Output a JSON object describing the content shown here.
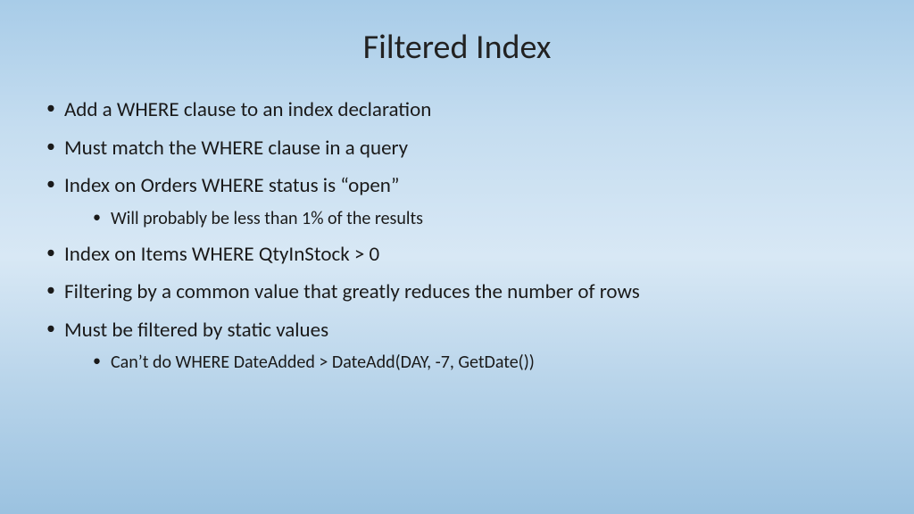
{
  "title": "Filtered Index",
  "bullets": [
    {
      "text": "Add a WHERE clause to an index declaration",
      "sub": []
    },
    {
      "text": "Must match the WHERE clause in a query",
      "sub": []
    },
    {
      "text": "Index on Orders WHERE status is “open”",
      "sub": [
        "Will probably be less than 1% of the results"
      ]
    },
    {
      "text": "Index on Items WHERE QtyInStock > 0",
      "sub": []
    },
    {
      "text": "Filtering by a common value that greatly reduces the number of rows",
      "sub": []
    },
    {
      "text": "Must be filtered by static values",
      "sub": [
        "Can’t do WHERE DateAdded > DateAdd(DAY, -7, GetDate())"
      ]
    }
  ]
}
